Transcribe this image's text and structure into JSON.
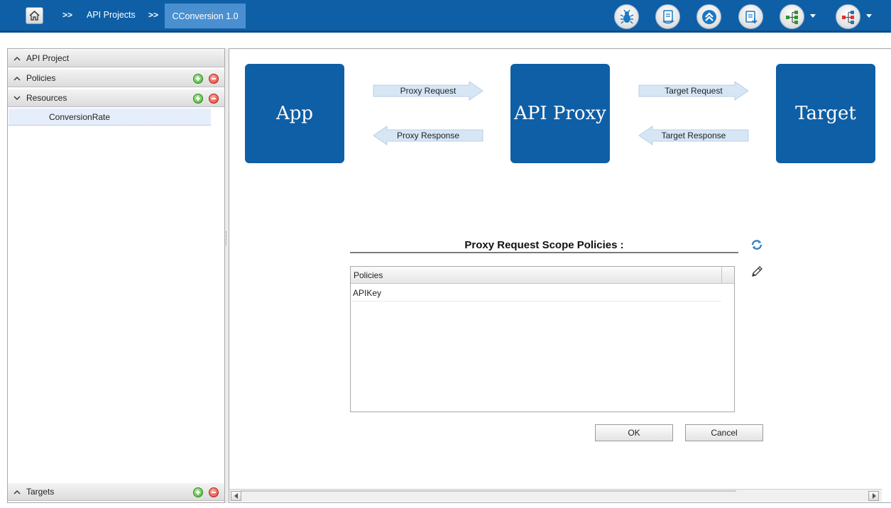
{
  "breadcrumb": {
    "separator": ">>",
    "items": [
      "API Projects"
    ],
    "current": "CConversion 1.0"
  },
  "toolbar": {
    "icons": [
      "debug-icon",
      "deploy-icon",
      "promote-icon",
      "save-icon",
      "policy-flow-green-icon",
      "policy-flow-red-icon"
    ]
  },
  "sidebar": {
    "sections": {
      "api_project": "API Project",
      "policies": "Policies",
      "resources": "Resources",
      "targets": "Targets"
    },
    "resource_items": [
      "ConversionRate"
    ]
  },
  "flow": {
    "app": "App",
    "proxy": "API Proxy",
    "target": "Target",
    "proxy_request": "Proxy Request",
    "proxy_response": "Proxy Response",
    "target_request": "Target Request",
    "target_response": "Target Response"
  },
  "scope": {
    "title": "Proxy Request Scope Policies :",
    "column_header": "Policies",
    "rows": [
      "APIKey"
    ]
  },
  "buttons": {
    "ok": "OK",
    "cancel": "Cancel"
  },
  "colors": {
    "brand_blue": "#0e5fa6",
    "active_tab": "#4a90d0",
    "arrow_fill": "#d6e6f4"
  }
}
